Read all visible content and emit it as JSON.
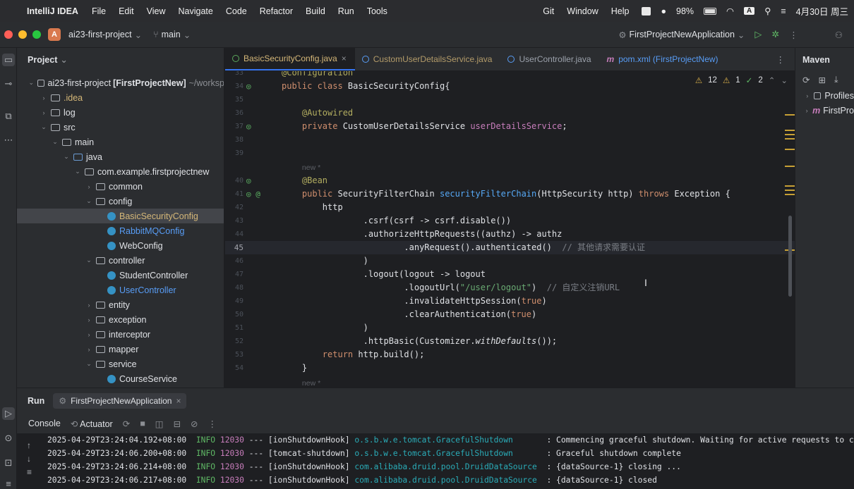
{
  "menubar": {
    "app": "IntelliJ IDEA",
    "items": [
      "File",
      "Edit",
      "View",
      "Navigate",
      "Code",
      "Refactor",
      "Build",
      "Run",
      "Tools"
    ],
    "right_items": [
      "Git",
      "Window",
      "Help"
    ],
    "battery": "98%",
    "input_method": "A",
    "date": "4月30日 周三"
  },
  "titlebar": {
    "project_badge": "A",
    "project": "ai23-first-project",
    "branch": "main",
    "run_config": "FirstProjectNewApplication"
  },
  "project_panel": {
    "title": "Project",
    "root_name": "ai23-first-project",
    "root_module": "[FirstProjectNew]",
    "root_path": "~/worksp",
    "nodes": {
      "idea": ".idea",
      "log": "log",
      "src": "src",
      "main": "main",
      "java": "java",
      "package": "com.example.firstprojectnew",
      "common": "common",
      "config": "config",
      "basic_security_config": "BasicSecurityConfig",
      "rabbitmq_config": "RabbitMQConfig",
      "web_config": "WebConfig",
      "controller": "controller",
      "student_controller": "StudentController",
      "user_controller": "UserController",
      "entity": "entity",
      "exception": "exception",
      "interceptor": "interceptor",
      "mapper": "mapper",
      "service": "service",
      "course_service": "CourseService"
    }
  },
  "tabs": [
    {
      "label": "BasicSecurityConfig.java",
      "active": true
    },
    {
      "label": "CustomUserDetailsService.java"
    },
    {
      "label": "UserController.java"
    },
    {
      "label": "pom.xml (FirstProjectNew)"
    }
  ],
  "inspections": {
    "warnings": "12",
    "weak_warnings": "1",
    "ok": "2"
  },
  "editor": {
    "line_numbers": [
      "33",
      "34",
      "35",
      "36",
      "37",
      "38",
      "39",
      "40",
      "41",
      "42",
      "43",
      "44",
      "45",
      "46",
      "47",
      "48",
      "49",
      "50",
      "51",
      "52",
      "53",
      "54"
    ],
    "usage_hint": "new *",
    "comment_auth": "// 其他请求需要认证",
    "comment_logout": "// 自定义注销URL",
    "logout_url": "\"/user/logout\""
  },
  "maven": {
    "title": "Maven",
    "items": [
      "Profiles",
      "FirstPro"
    ]
  },
  "run": {
    "title": "Run",
    "tab": "FirstProjectNewApplication",
    "console_tab": "Console",
    "actuator_tab": "Actuator",
    "log": [
      {
        "ts": "2025-04-29T23:24:04.192+08:00",
        "level": "INFO",
        "pid": "12030",
        "thread": "--- [ionShutdownHook]",
        "logger": "o.s.b.w.e.tomcat.GracefulShutdown      ",
        "msg": ": Commencing graceful shutdown. Waiting for active requests to c"
      },
      {
        "ts": "2025-04-29T23:24:06.200+08:00",
        "level": "INFO",
        "pid": "12030",
        "thread": "--- [tomcat-shutdown]",
        "logger": "o.s.b.w.e.tomcat.GracefulShutdown      ",
        "msg": ": Graceful shutdown complete"
      },
      {
        "ts": "2025-04-29T23:24:06.214+08:00",
        "level": "INFO",
        "pid": "12030",
        "thread": "--- [ionShutdownHook]",
        "logger": "com.alibaba.druid.pool.DruidDataSource ",
        "msg": ": {dataSource-1} closing ..."
      },
      {
        "ts": "2025-04-29T23:24:06.217+08:00",
        "level": "INFO",
        "pid": "12030",
        "thread": "--- [ionShutdownHook]",
        "logger": "com.alibaba.druid.pool.DruidDataSource ",
        "msg": ": {dataSource-1} closed"
      }
    ]
  }
}
